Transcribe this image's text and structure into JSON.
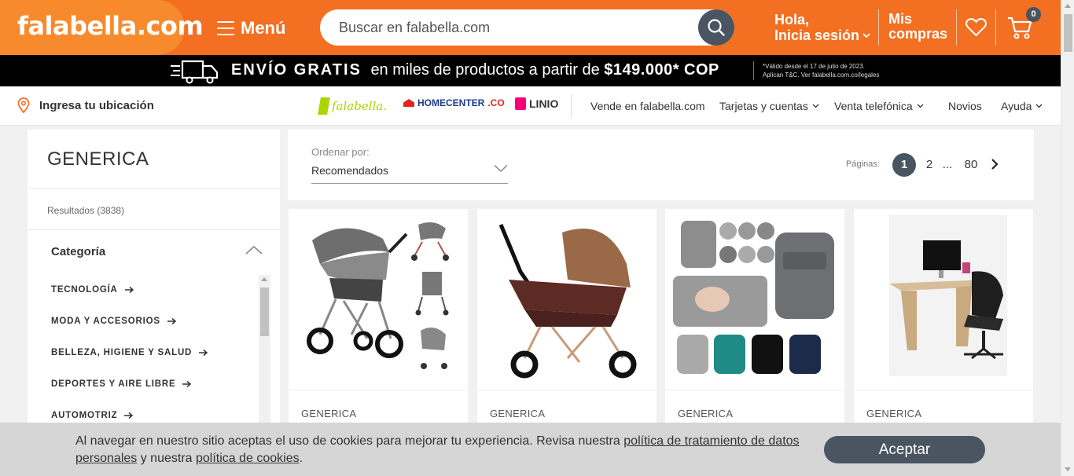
{
  "header": {
    "logo": "falabella.com",
    "menu_label": "Menú",
    "search_placeholder": "Buscar en falabella.com",
    "greeting_line1": "Hola,",
    "greeting_line2": "Inicia sesión",
    "orders_line1": "Mis",
    "orders_line2": "compras",
    "cart_count": "0",
    "brand_color": "#f36f21"
  },
  "promo": {
    "headline": "ENVÍO GRATIS",
    "text": "en miles de productos a partir de",
    "amount": "$149.000* COP",
    "legal_line1": "*Válido desde el 17 de julio de 2023.",
    "legal_line2": "Aplican T&C. Ver falabella.com.co/legales"
  },
  "subnav": {
    "location": "Ingresa tu ubicación",
    "brand_falabella": "falabella.",
    "brand_homecenter": "HOMECENTER",
    "brand_homecenter_suffix": ".CO",
    "brand_linio": "LINIO",
    "links": [
      {
        "label": "Vende en falabella.com"
      },
      {
        "label": "Tarjetas y cuentas"
      },
      {
        "label": "Venta telefónica"
      },
      {
        "label": "Novios"
      },
      {
        "label": "Ayuda"
      }
    ]
  },
  "sidebar": {
    "title": "GENERICA",
    "results": "Resultados (3838)",
    "category_heading": "Categoría",
    "categories": [
      {
        "label": "TECNOLOGÍA"
      },
      {
        "label": "MODA Y ACCESORIOS"
      },
      {
        "label": "BELLEZA, HIGIENE Y SALUD"
      },
      {
        "label": "DEPORTES Y AIRE LIBRE"
      },
      {
        "label": "AUTOMOTRIZ"
      }
    ]
  },
  "sort": {
    "label": "Ordenar por:",
    "value": "Recomendados",
    "pages_label": "Páginas:",
    "pages": [
      "1",
      "2",
      "...",
      "80"
    ],
    "current_page": "1"
  },
  "products": [
    {
      "brand": "GENERICA",
      "image": "stroller-gray-icon"
    },
    {
      "brand": "GENERICA",
      "image": "stroller-brown-icon"
    },
    {
      "brand": "GENERICA",
      "image": "diaper-backpack-icon"
    },
    {
      "brand": "GENERICA",
      "image": "office-desk-icon"
    }
  ],
  "cookie": {
    "text1": "Al navegar en nuestro sitio aceptas el uso de cookies para mejorar tu experiencia. Revisa nuestra",
    "link1": "política de tratamiento de datos personales",
    "text2": "y nuestra",
    "link2": "política de cookies",
    "text3": ".",
    "accept_label": "Aceptar"
  }
}
